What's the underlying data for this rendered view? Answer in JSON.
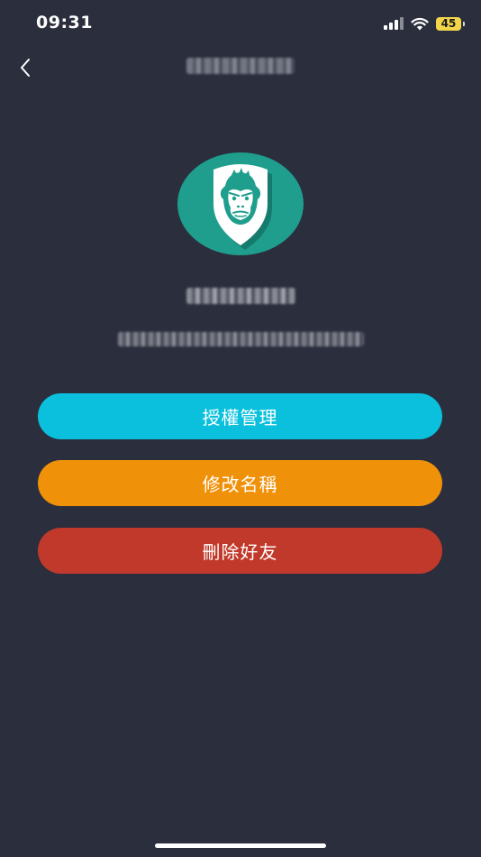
{
  "status_bar": {
    "time": "09:31",
    "battery_level": "45",
    "icons": [
      "signal-icon",
      "wifi-icon",
      "battery-icon"
    ]
  },
  "nav": {
    "back_icon": "chevron-left-icon",
    "title": ""
  },
  "profile": {
    "avatar_icon": "monkey-shield-icon",
    "name": "",
    "email": ""
  },
  "actions": {
    "authorize_label": "授權管理",
    "rename_label": "修改名稱",
    "delete_label": "刪除好友"
  },
  "colors": {
    "background": "#2b2e3d",
    "authorize": "#0ac0dc",
    "rename": "#f0910a",
    "delete": "#c0392b",
    "avatar": "#1f9e8d"
  }
}
